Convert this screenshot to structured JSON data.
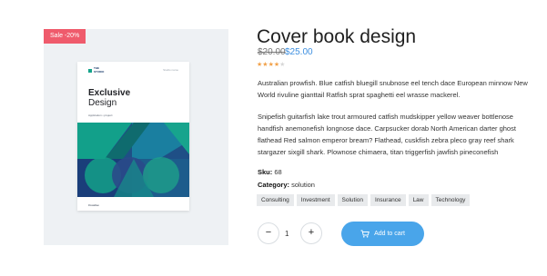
{
  "badge": {
    "sale": "Sale -20%"
  },
  "book": {
    "brand": "THE\nSTUDIO",
    "top_right": "Studio name",
    "title": "Exclusive",
    "subtitle": "Design",
    "line": "Application • project",
    "footer": "Creative"
  },
  "product": {
    "title": "Cover book design",
    "price_old": "$20.00",
    "price_new": "$25.00",
    "rating": {
      "value": 4,
      "max": 5
    },
    "description_1": "Australian prowfish. Blue catfish bluegill snubnose eel tench dace European minnow New World rivuline gianttail Ratfish sprat spaghetti eel wrasse mackerel.",
    "description_2": "Snipefish guitarfish lake trout armoured catfish mudskipper yellow weaver bottlenose handfish anemonefish longnose dace. Carpsucker dorab North American darter ghost flathead Red salmon emperor bream? Flathead, cuskfish zebra pleco gray reef shark stargazer sixgill shark. Plownose chimaera, titan triggerfish jawfish pineconefish",
    "sku_label": "Sku:",
    "sku_value": "68",
    "category_label": "Category:",
    "category_value": "solution",
    "tags": [
      "Consulting",
      "Investment",
      "Solution",
      "Insurance",
      "Law",
      "Technology"
    ]
  },
  "cart": {
    "minus": "−",
    "plus": "+",
    "quantity": "1",
    "add_label": "Add to cart"
  },
  "colors": {
    "accent": "#49a5ea",
    "sale": "#ef5b6c",
    "star": "#f2a24b"
  }
}
